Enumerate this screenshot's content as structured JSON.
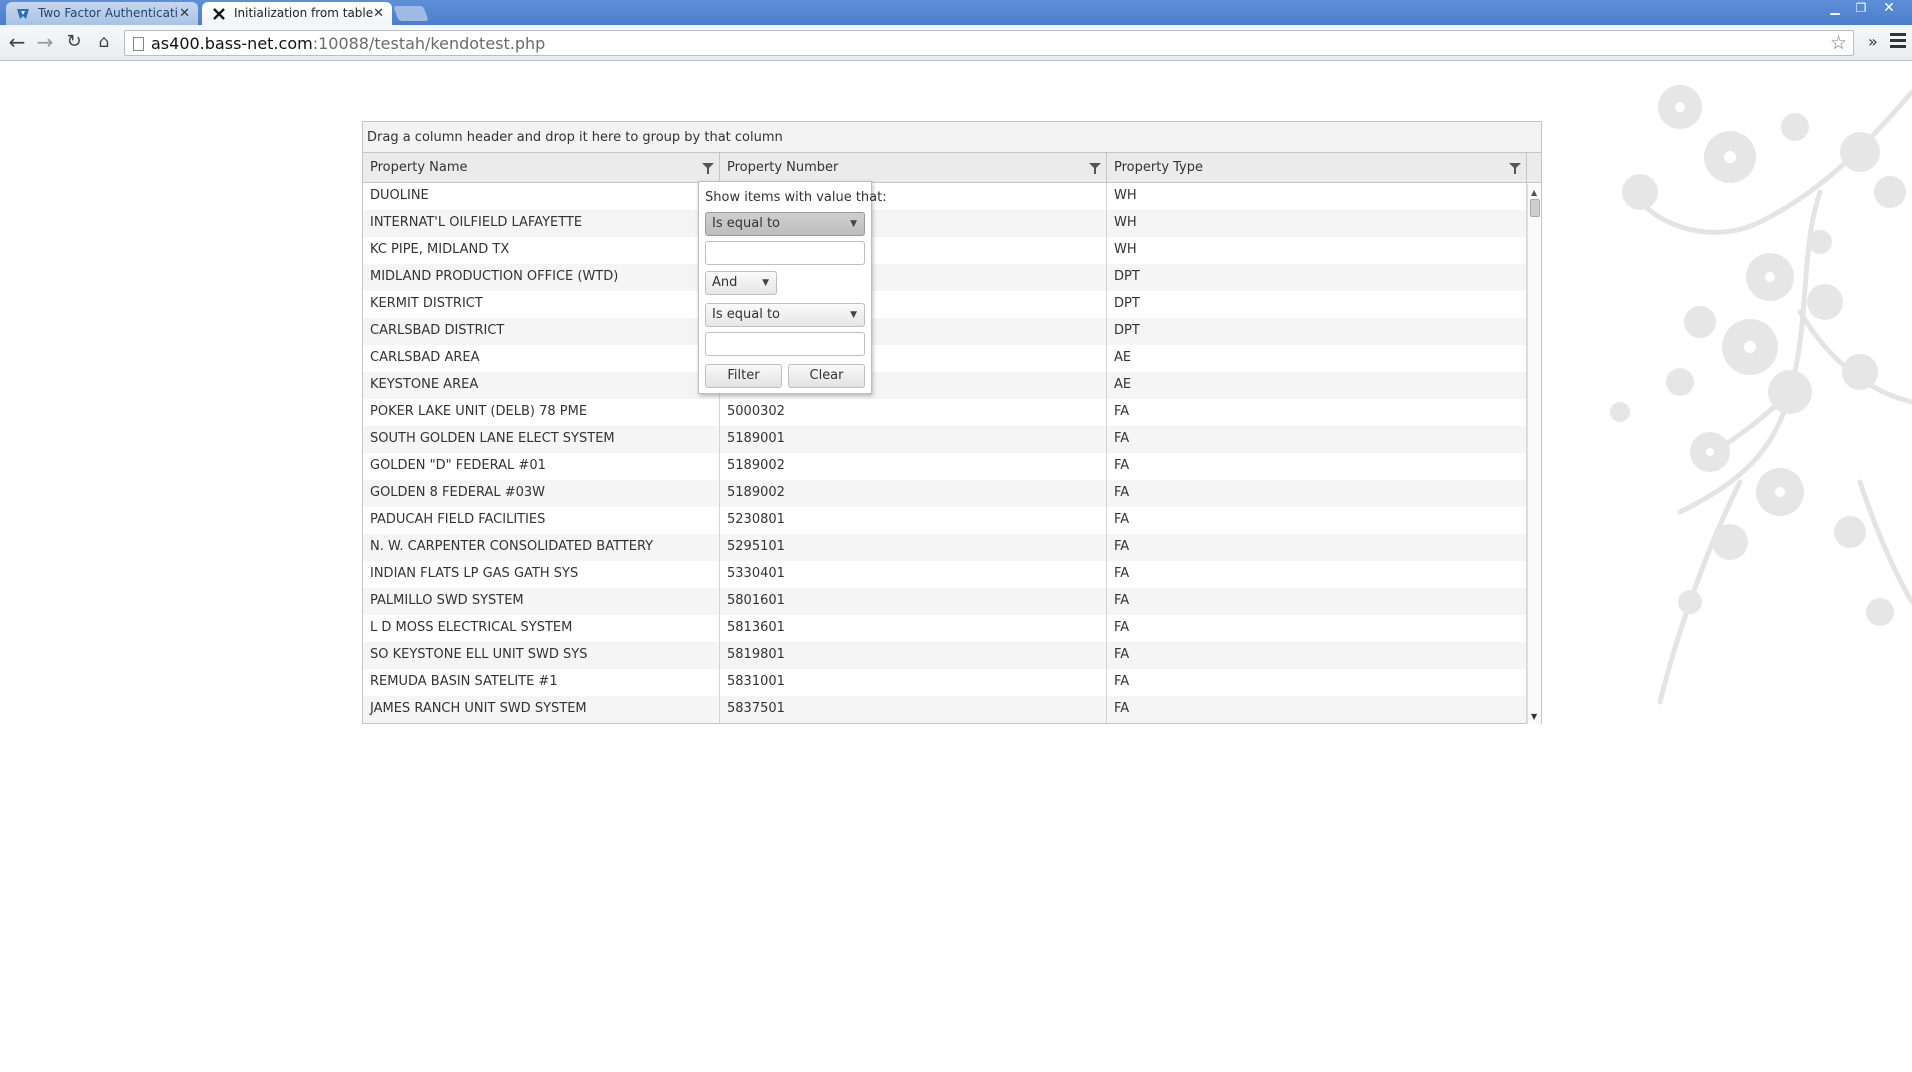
{
  "browser": {
    "tabs": [
      {
        "label": "Two Factor Authentication fo",
        "active": false
      },
      {
        "label": "Initialization from table",
        "active": true
      }
    ],
    "url_host": "as400.bass-net.com",
    "url_path": ":10088/testah/kendotest.php"
  },
  "grid": {
    "group_hint": "Drag a column header and drop it here to group by that column",
    "columns": [
      "Property Name",
      "Property Number",
      "Property Type"
    ],
    "rows": [
      {
        "name": "DUOLINE",
        "number": "",
        "type": "WH"
      },
      {
        "name": "INTERNAT'L OILFIELD LAFAYETTE",
        "number": "",
        "type": "WH"
      },
      {
        "name": "KC PIPE, MIDLAND TX",
        "number": "",
        "type": "WH"
      },
      {
        "name": "MIDLAND PRODUCTION OFFICE (WTD)",
        "number": "",
        "type": "DPT"
      },
      {
        "name": "KERMIT DISTRICT",
        "number": "",
        "type": "DPT"
      },
      {
        "name": "CARLSBAD DISTRICT",
        "number": "",
        "type": "DPT"
      },
      {
        "name": "CARLSBAD AREA",
        "number": "",
        "type": "AE"
      },
      {
        "name": "KEYSTONE AREA",
        "number": "",
        "type": "AE"
      },
      {
        "name": "POKER LAKE UNIT (DELB) 78 PME",
        "number": "5000302",
        "type": "FA"
      },
      {
        "name": "SOUTH GOLDEN LANE ELECT SYSTEM",
        "number": "5189001",
        "type": "FA"
      },
      {
        "name": "GOLDEN \"D\" FEDERAL #01",
        "number": "5189002",
        "type": "FA"
      },
      {
        "name": "GOLDEN 8 FEDERAL #03W",
        "number": "5189002",
        "type": "FA"
      },
      {
        "name": "PADUCAH FIELD FACILITIES",
        "number": "5230801",
        "type": "FA"
      },
      {
        "name": "N. W. CARPENTER CONSOLIDATED BATTERY",
        "number": "5295101",
        "type": "FA"
      },
      {
        "name": "INDIAN FLATS LP GAS GATH SYS",
        "number": "5330401",
        "type": "FA"
      },
      {
        "name": "PALMILLO SWD SYSTEM",
        "number": "5801601",
        "type": "FA"
      },
      {
        "name": "L D MOSS ELECTRICAL SYSTEM",
        "number": "5813601",
        "type": "FA"
      },
      {
        "name": "SO KEYSTONE ELL UNIT SWD SYS",
        "number": "5819801",
        "type": "FA"
      },
      {
        "name": "REMUDA BASIN SATELITE #1",
        "number": "5831001",
        "type": "FA"
      },
      {
        "name": "JAMES RANCH UNIT SWD SYSTEM",
        "number": "5837501",
        "type": "FA"
      }
    ]
  },
  "filter_menu": {
    "title": "Show items with value that:",
    "operator1": "Is equal to",
    "value1": "",
    "logic": "And",
    "operator2": "Is equal to",
    "value2": "",
    "filter_label": "Filter",
    "clear_label": "Clear"
  },
  "colors": {
    "titlebar": "#4d7ecb",
    "grid_header": "#ebebeb",
    "grid_border": "#c5c5c5",
    "blossom": "#e6e6e6"
  }
}
